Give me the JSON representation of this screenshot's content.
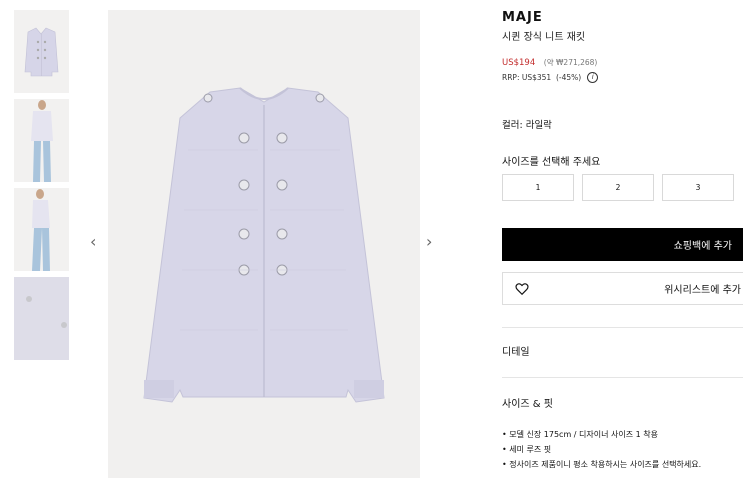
{
  "gallery": {
    "thumbnails": [
      {
        "label": "front"
      },
      {
        "label": "model-front"
      },
      {
        "label": "model-side"
      },
      {
        "label": "detail"
      }
    ],
    "prev_arrow": "‹",
    "next_arrow": "›"
  },
  "product": {
    "brand": "MAJE",
    "name": "시퀸 장식 니트 재킷",
    "price_sale": "US$194",
    "price_approx": "(약 ₩271,268)",
    "rrp": "RRP: US$351  (-45%)",
    "info_icon": "i",
    "color_label": "컬러: 라일락",
    "size_prompt": "사이즈를 선택해 주세요",
    "sizes": [
      "1",
      "2",
      "3"
    ],
    "add_to_bag": "쇼핑백에 추가",
    "wishlist": "위시리스트에 추가",
    "details_label": "디테일",
    "size_fit_label": "사이즈 & 핏",
    "fit_notes": [
      "모델 신장 175cm / 디자이너 사이즈 1 착용",
      "세미 루즈 핏",
      "정사이즈 제품이니 평소 착용하시는 사이즈를 선택하세요."
    ]
  },
  "colors": {
    "jacket": "#d4d3e6",
    "sale": "#c32d2d",
    "background": "#f1f0ef"
  }
}
